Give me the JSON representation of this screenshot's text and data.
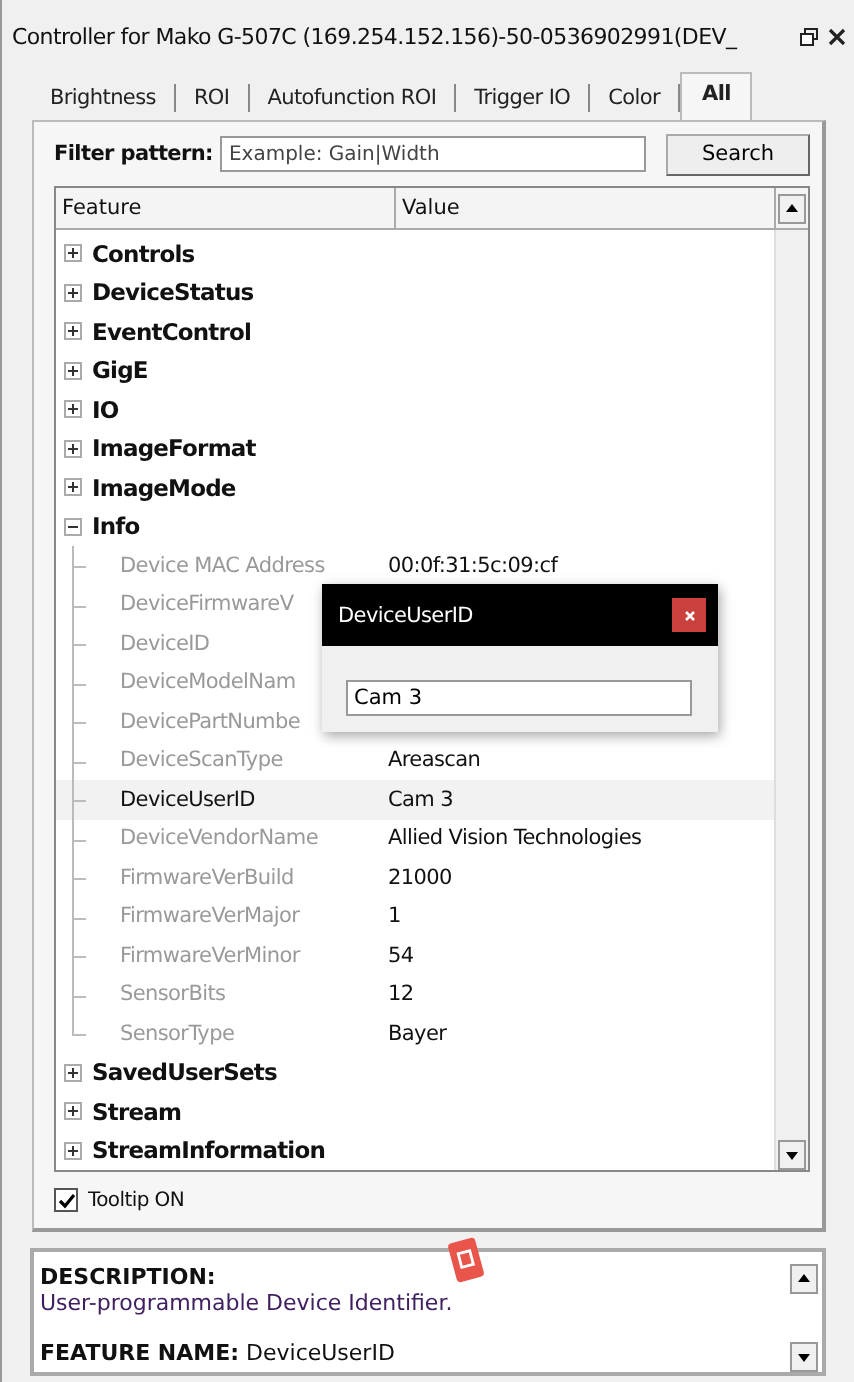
{
  "window": {
    "title": "Controller for Mako G-507C (169.254.152.156)-50-0536902991(DEV_"
  },
  "tabs": [
    {
      "label": "Brightness",
      "selected": false
    },
    {
      "label": "ROI",
      "selected": false
    },
    {
      "label": "Autofunction ROI",
      "selected": false
    },
    {
      "label": "Trigger IO",
      "selected": false
    },
    {
      "label": "Color",
      "selected": false
    },
    {
      "label": "All",
      "selected": true
    }
  ],
  "filter": {
    "label": "Filter pattern:",
    "placeholder": "Example: Gain|Width",
    "button": "Search"
  },
  "tree": {
    "columns": [
      "Feature",
      "Value"
    ],
    "items": [
      {
        "name": "Controls",
        "expanded": false
      },
      {
        "name": "DeviceStatus",
        "expanded": false
      },
      {
        "name": "EventControl",
        "expanded": false
      },
      {
        "name": "GigE",
        "expanded": false
      },
      {
        "name": "IO",
        "expanded": false
      },
      {
        "name": "ImageFormat",
        "expanded": false
      },
      {
        "name": "ImageMode",
        "expanded": false
      },
      {
        "name": "Info",
        "expanded": true,
        "children": [
          {
            "name": "Device MAC Address",
            "value": "00:0f:31:5c:09:cf",
            "disabled": true,
            "selected": false
          },
          {
            "name": "DeviceFirmwareV",
            "disabled": true,
            "selected": false
          },
          {
            "name": "DeviceID",
            "disabled": true,
            "selected": false
          },
          {
            "name": "DeviceModelNam",
            "disabled": true,
            "selected": false
          },
          {
            "name": "DevicePartNumbe",
            "disabled": true,
            "selected": false
          },
          {
            "name": "DeviceScanType",
            "value": "Areascan",
            "disabled": true,
            "selected": false
          },
          {
            "name": "DeviceUserID",
            "value": "Cam 3",
            "disabled": false,
            "selected": true
          },
          {
            "name": "DeviceVendorName",
            "value": "Allied Vision Technologies",
            "disabled": true,
            "selected": false
          },
          {
            "name": "FirmwareVerBuild",
            "value": "21000",
            "disabled": true,
            "selected": false
          },
          {
            "name": "FirmwareVerMajor",
            "value": "1",
            "disabled": true,
            "selected": false
          },
          {
            "name": "FirmwareVerMinor",
            "value": "54",
            "disabled": true,
            "selected": false
          },
          {
            "name": "SensorBits",
            "value": "12",
            "disabled": true,
            "selected": false
          },
          {
            "name": "SensorType",
            "value": "Bayer",
            "disabled": true,
            "selected": false
          }
        ]
      },
      {
        "name": "SavedUserSets",
        "expanded": false
      },
      {
        "name": "Stream",
        "expanded": false
      },
      {
        "name": "StreamInformation",
        "expanded": false
      }
    ]
  },
  "tooltip": {
    "label": "Tooltip ON",
    "checked": true
  },
  "description": {
    "heading": "DESCRIPTION:",
    "text": "User-programmable Device Identifier.",
    "feature": "**FEATURE NAME:** DeviceUserID"
  },
  "dialog": {
    "title": "DeviceUserID",
    "value": "Cam 3"
  }
}
